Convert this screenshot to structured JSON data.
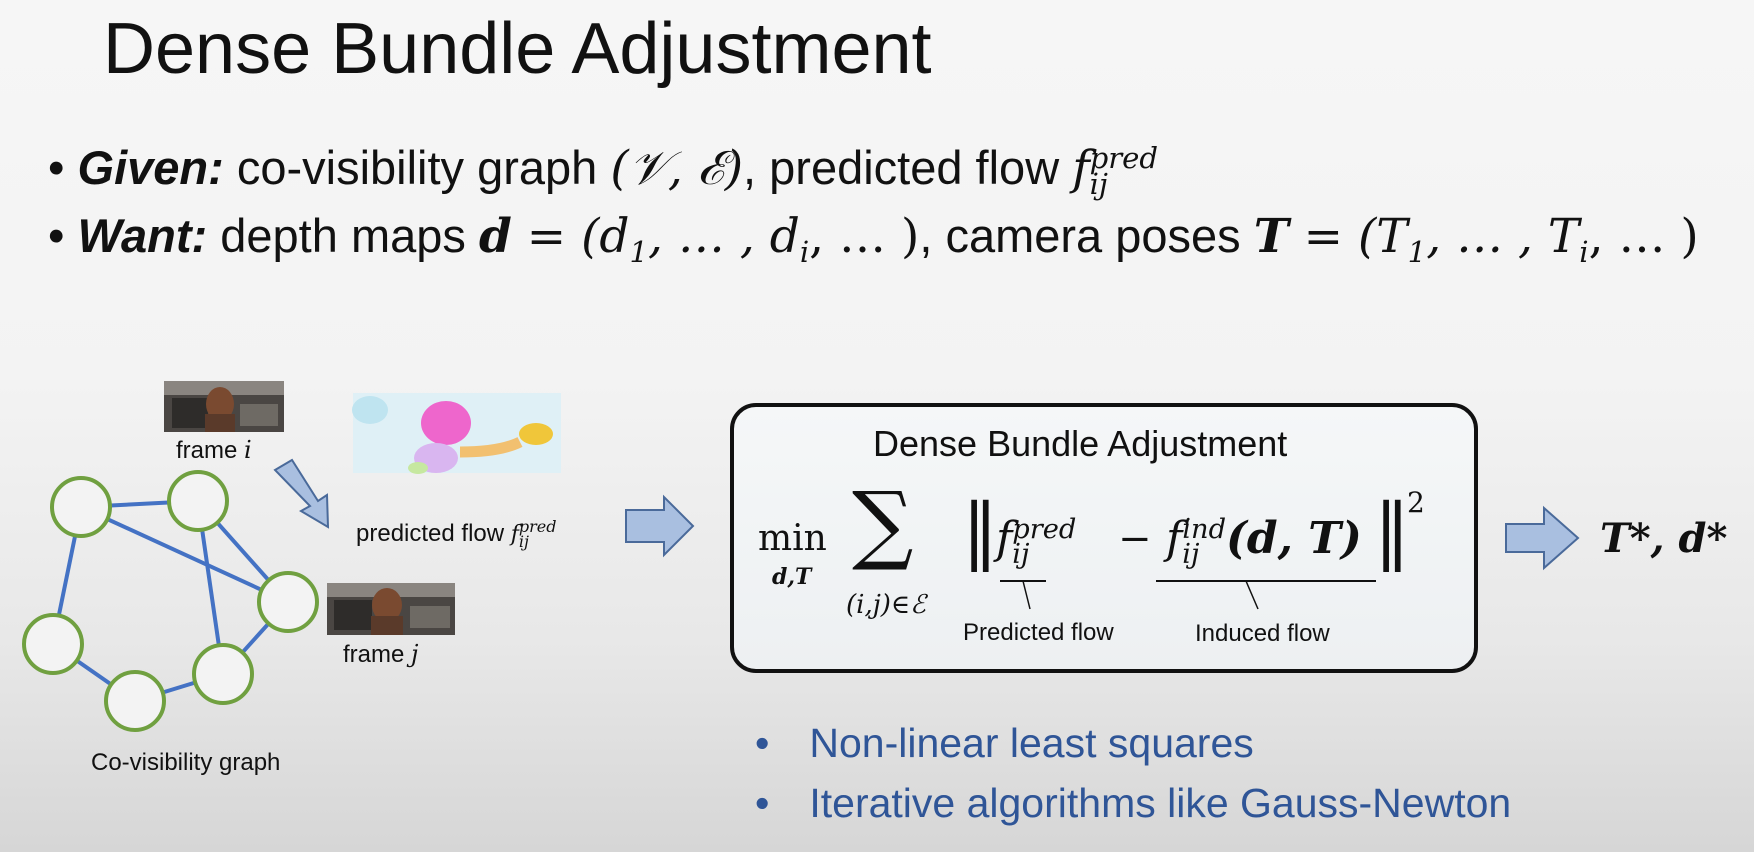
{
  "title": "Dense Bundle Adjustment",
  "bullets": {
    "given_lead": "Given:",
    "given_text": "co-visibility graph",
    "given_graph": "(𝒱, ℰ)",
    "given_text2": ", predicted flow",
    "want_lead": "Want:",
    "want_text": "depth maps",
    "want_d": "d",
    "want_d_tuple_pre": "= (d",
    "want_d_tuple_1": "1",
    "want_d_tuple_mid": ", … , d",
    "want_d_tuple_i": "i",
    "want_d_tuple_post": ", … )",
    "want_text2": ", camera poses",
    "want_T": "T",
    "want_T_tuple_pre": "= (T",
    "want_T_tuple_1": "1",
    "want_T_tuple_mid": ", … , T",
    "want_T_tuple_i": "i",
    "want_T_tuple_post": ", … )"
  },
  "symbols": {
    "f": "f",
    "pred": "pred",
    "ind": "ind",
    "ij": "ij",
    "min": "min",
    "min_sub": "d,T",
    "sum": "∑",
    "sum_sub": "(i,j)∈ℰ",
    "norm": "‖",
    "minus": "−",
    "args": "(d, T)",
    "square": "2",
    "result": "T*, d*"
  },
  "diagram": {
    "frame_i": "frame",
    "frame_j": "frame",
    "i": "i",
    "j": "j",
    "predicted_flow": "predicted flow",
    "graph_caption": "Co-visibility graph",
    "box_title": "Dense Bundle Adjustment",
    "predicted_flow_label": "Predicted flow",
    "induced_flow_label": "Induced flow"
  },
  "notes": [
    "Non-linear least squares",
    "Iterative algorithms like Gauss-Newton"
  ],
  "colors": {
    "graph_node": "#70a040",
    "graph_edge": "#4472c4",
    "arrow_fill": "#a9bfe0",
    "arrow_stroke": "#4a6a9a",
    "note_text": "#2f5597"
  }
}
